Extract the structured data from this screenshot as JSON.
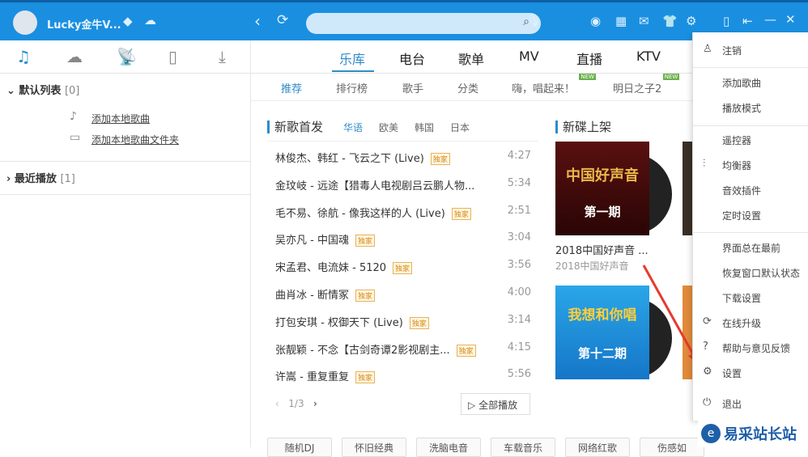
{
  "topbar": {
    "username": "Lucky金牛V...",
    "search_placeholder": ""
  },
  "sidebar": {
    "groups": [
      {
        "label": "默认列表",
        "count": "[0]"
      },
      {
        "label": "最近播放",
        "count": "[1]"
      }
    ],
    "actions": [
      "添加本地歌曲",
      "添加本地歌曲文件夹"
    ]
  },
  "nav": {
    "tabs": [
      "乐库",
      "电台",
      "歌单",
      "MV",
      "直播",
      "KTV"
    ],
    "subtabs": [
      "推荐",
      "排行榜",
      "歌手",
      "分类",
      "嗨，唱起来！",
      "明日之子2"
    ],
    "new_badge": "NEW"
  },
  "new_songs": {
    "title": "新歌首发",
    "regions": [
      "华语",
      "欧美",
      "韩国",
      "日本"
    ],
    "exclusive": "独家",
    "songs": [
      {
        "title": "林俊杰、韩红 - 飞云之下 (Live)",
        "dur": "4:27",
        "ex": true
      },
      {
        "title": "金玟岐 - 远途【猎毒人电视剧吕云鹏人物...",
        "dur": "5:34",
        "ex": false
      },
      {
        "title": "毛不易、徐航 - 像我这样的人 (Live)",
        "dur": "2:51",
        "ex": true
      },
      {
        "title": "吴亦凡 - 中国魂",
        "dur": "3:04",
        "ex": true
      },
      {
        "title": "宋孟君、电流妹 - 5120",
        "dur": "3:56",
        "ex": true
      },
      {
        "title": "曲肖冰 - 断情冢",
        "dur": "4:00",
        "ex": true
      },
      {
        "title": "打包安琪 - 权御天下 (Live)",
        "dur": "3:14",
        "ex": true
      },
      {
        "title": "张靓颖 - 不念【古剑奇谭2影视剧主...",
        "dur": "4:15",
        "ex": true
      },
      {
        "title": "许嵩 - 重复重复",
        "dur": "5:56",
        "ex": true
      }
    ],
    "page": "1/3",
    "play_all": "全部播放"
  },
  "new_albums": {
    "title": "新碟上架",
    "albums": [
      {
        "name": "2018中国好声音 ...",
        "artist": "2018中国好声音",
        "cover_text": "第一期"
      },
      {
        "name": "",
        "artist": "",
        "cover_text": "第十二期"
      }
    ]
  },
  "tags": [
    "随机DJ",
    "怀旧经典",
    "洗脑电音",
    "车载音乐",
    "网络红歌",
    "伤感如"
  ],
  "menu": {
    "items": [
      "注销",
      "添加歌曲",
      "播放模式",
      "遥控器",
      "均衡器",
      "音效插件",
      "定时设置",
      "界面总在最前",
      "恢复窗口默认状态",
      "下载设置",
      "在线升级",
      "帮助与意见反馈",
      "设置",
      "退出"
    ]
  },
  "watermark": "易采站长站",
  "colors": {
    "brand": "#1a8fe0",
    "accent": "#2f8cc8"
  }
}
